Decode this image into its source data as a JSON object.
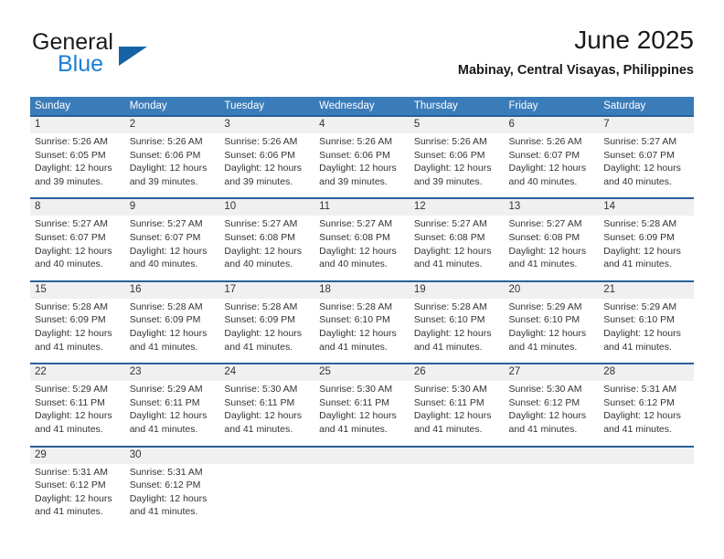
{
  "brand": {
    "name_top": "General",
    "name_bottom": "Blue",
    "accent_color": "#1464a5",
    "blue_text_color": "#1b7fd4"
  },
  "header": {
    "title": "June 2025",
    "location": "Mabinay, Central Visayas, Philippines"
  },
  "theme": {
    "header_bg": "#3a7cba",
    "row_rule": "#2a6099",
    "daynum_bg": "#f0f0f0",
    "text": "#333333"
  },
  "calendar": {
    "weekday_headers": [
      "Sunday",
      "Monday",
      "Tuesday",
      "Wednesday",
      "Thursday",
      "Friday",
      "Saturday"
    ],
    "labels": {
      "sunrise_prefix": "Sunrise:",
      "sunset_prefix": "Sunset:",
      "daylight_prefix": "Daylight:"
    },
    "weeks": [
      [
        {
          "day": "1",
          "sunrise": "Sunrise: 5:26 AM",
          "sunset": "Sunset: 6:05 PM",
          "daylight_1": "Daylight: 12 hours",
          "daylight_2": "and 39 minutes."
        },
        {
          "day": "2",
          "sunrise": "Sunrise: 5:26 AM",
          "sunset": "Sunset: 6:06 PM",
          "daylight_1": "Daylight: 12 hours",
          "daylight_2": "and 39 minutes."
        },
        {
          "day": "3",
          "sunrise": "Sunrise: 5:26 AM",
          "sunset": "Sunset: 6:06 PM",
          "daylight_1": "Daylight: 12 hours",
          "daylight_2": "and 39 minutes."
        },
        {
          "day": "4",
          "sunrise": "Sunrise: 5:26 AM",
          "sunset": "Sunset: 6:06 PM",
          "daylight_1": "Daylight: 12 hours",
          "daylight_2": "and 39 minutes."
        },
        {
          "day": "5",
          "sunrise": "Sunrise: 5:26 AM",
          "sunset": "Sunset: 6:06 PM",
          "daylight_1": "Daylight: 12 hours",
          "daylight_2": "and 39 minutes."
        },
        {
          "day": "6",
          "sunrise": "Sunrise: 5:26 AM",
          "sunset": "Sunset: 6:07 PM",
          "daylight_1": "Daylight: 12 hours",
          "daylight_2": "and 40 minutes."
        },
        {
          "day": "7",
          "sunrise": "Sunrise: 5:27 AM",
          "sunset": "Sunset: 6:07 PM",
          "daylight_1": "Daylight: 12 hours",
          "daylight_2": "and 40 minutes."
        }
      ],
      [
        {
          "day": "8",
          "sunrise": "Sunrise: 5:27 AM",
          "sunset": "Sunset: 6:07 PM",
          "daylight_1": "Daylight: 12 hours",
          "daylight_2": "and 40 minutes."
        },
        {
          "day": "9",
          "sunrise": "Sunrise: 5:27 AM",
          "sunset": "Sunset: 6:07 PM",
          "daylight_1": "Daylight: 12 hours",
          "daylight_2": "and 40 minutes."
        },
        {
          "day": "10",
          "sunrise": "Sunrise: 5:27 AM",
          "sunset": "Sunset: 6:08 PM",
          "daylight_1": "Daylight: 12 hours",
          "daylight_2": "and 40 minutes."
        },
        {
          "day": "11",
          "sunrise": "Sunrise: 5:27 AM",
          "sunset": "Sunset: 6:08 PM",
          "daylight_1": "Daylight: 12 hours",
          "daylight_2": "and 40 minutes."
        },
        {
          "day": "12",
          "sunrise": "Sunrise: 5:27 AM",
          "sunset": "Sunset: 6:08 PM",
          "daylight_1": "Daylight: 12 hours",
          "daylight_2": "and 41 minutes."
        },
        {
          "day": "13",
          "sunrise": "Sunrise: 5:27 AM",
          "sunset": "Sunset: 6:08 PM",
          "daylight_1": "Daylight: 12 hours",
          "daylight_2": "and 41 minutes."
        },
        {
          "day": "14",
          "sunrise": "Sunrise: 5:28 AM",
          "sunset": "Sunset: 6:09 PM",
          "daylight_1": "Daylight: 12 hours",
          "daylight_2": "and 41 minutes."
        }
      ],
      [
        {
          "day": "15",
          "sunrise": "Sunrise: 5:28 AM",
          "sunset": "Sunset: 6:09 PM",
          "daylight_1": "Daylight: 12 hours",
          "daylight_2": "and 41 minutes."
        },
        {
          "day": "16",
          "sunrise": "Sunrise: 5:28 AM",
          "sunset": "Sunset: 6:09 PM",
          "daylight_1": "Daylight: 12 hours",
          "daylight_2": "and 41 minutes."
        },
        {
          "day": "17",
          "sunrise": "Sunrise: 5:28 AM",
          "sunset": "Sunset: 6:09 PM",
          "daylight_1": "Daylight: 12 hours",
          "daylight_2": "and 41 minutes."
        },
        {
          "day": "18",
          "sunrise": "Sunrise: 5:28 AM",
          "sunset": "Sunset: 6:10 PM",
          "daylight_1": "Daylight: 12 hours",
          "daylight_2": "and 41 minutes."
        },
        {
          "day": "19",
          "sunrise": "Sunrise: 5:28 AM",
          "sunset": "Sunset: 6:10 PM",
          "daylight_1": "Daylight: 12 hours",
          "daylight_2": "and 41 minutes."
        },
        {
          "day": "20",
          "sunrise": "Sunrise: 5:29 AM",
          "sunset": "Sunset: 6:10 PM",
          "daylight_1": "Daylight: 12 hours",
          "daylight_2": "and 41 minutes."
        },
        {
          "day": "21",
          "sunrise": "Sunrise: 5:29 AM",
          "sunset": "Sunset: 6:10 PM",
          "daylight_1": "Daylight: 12 hours",
          "daylight_2": "and 41 minutes."
        }
      ],
      [
        {
          "day": "22",
          "sunrise": "Sunrise: 5:29 AM",
          "sunset": "Sunset: 6:11 PM",
          "daylight_1": "Daylight: 12 hours",
          "daylight_2": "and 41 minutes."
        },
        {
          "day": "23",
          "sunrise": "Sunrise: 5:29 AM",
          "sunset": "Sunset: 6:11 PM",
          "daylight_1": "Daylight: 12 hours",
          "daylight_2": "and 41 minutes."
        },
        {
          "day": "24",
          "sunrise": "Sunrise: 5:30 AM",
          "sunset": "Sunset: 6:11 PM",
          "daylight_1": "Daylight: 12 hours",
          "daylight_2": "and 41 minutes."
        },
        {
          "day": "25",
          "sunrise": "Sunrise: 5:30 AM",
          "sunset": "Sunset: 6:11 PM",
          "daylight_1": "Daylight: 12 hours",
          "daylight_2": "and 41 minutes."
        },
        {
          "day": "26",
          "sunrise": "Sunrise: 5:30 AM",
          "sunset": "Sunset: 6:11 PM",
          "daylight_1": "Daylight: 12 hours",
          "daylight_2": "and 41 minutes."
        },
        {
          "day": "27",
          "sunrise": "Sunrise: 5:30 AM",
          "sunset": "Sunset: 6:12 PM",
          "daylight_1": "Daylight: 12 hours",
          "daylight_2": "and 41 minutes."
        },
        {
          "day": "28",
          "sunrise": "Sunrise: 5:31 AM",
          "sunset": "Sunset: 6:12 PM",
          "daylight_1": "Daylight: 12 hours",
          "daylight_2": "and 41 minutes."
        }
      ],
      [
        {
          "day": "29",
          "sunrise": "Sunrise: 5:31 AM",
          "sunset": "Sunset: 6:12 PM",
          "daylight_1": "Daylight: 12 hours",
          "daylight_2": "and 41 minutes."
        },
        {
          "day": "30",
          "sunrise": "Sunrise: 5:31 AM",
          "sunset": "Sunset: 6:12 PM",
          "daylight_1": "Daylight: 12 hours",
          "daylight_2": "and 41 minutes."
        },
        {
          "day": "",
          "sunrise": "",
          "sunset": "",
          "daylight_1": "",
          "daylight_2": ""
        },
        {
          "day": "",
          "sunrise": "",
          "sunset": "",
          "daylight_1": "",
          "daylight_2": ""
        },
        {
          "day": "",
          "sunrise": "",
          "sunset": "",
          "daylight_1": "",
          "daylight_2": ""
        },
        {
          "day": "",
          "sunrise": "",
          "sunset": "",
          "daylight_1": "",
          "daylight_2": ""
        },
        {
          "day": "",
          "sunrise": "",
          "sunset": "",
          "daylight_1": "",
          "daylight_2": ""
        }
      ]
    ]
  }
}
